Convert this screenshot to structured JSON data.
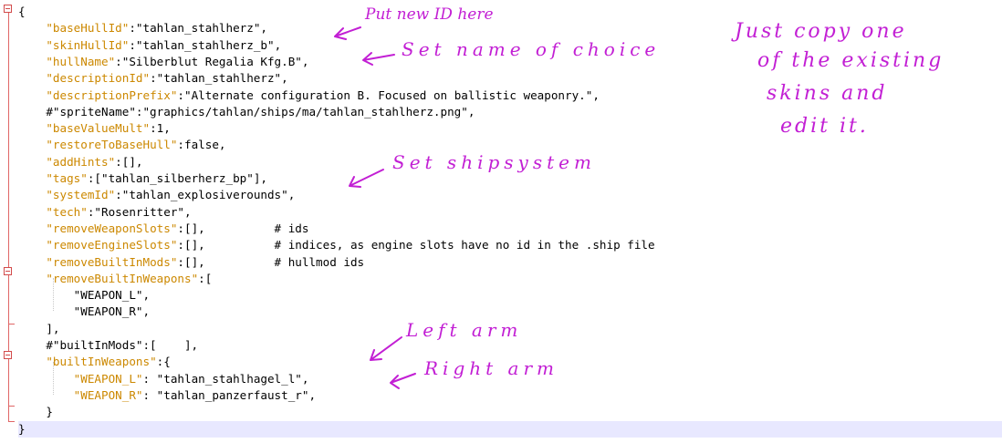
{
  "lines": [
    {
      "t": "{",
      "parts": [
        {
          "c": "{",
          "k": 0
        }
      ]
    },
    {
      "parts": [
        {
          "c": "    ",
          "k": 0
        },
        {
          "c": "\"baseHullId\"",
          "k": 1
        },
        {
          "c": ":\"tahlan_stahlherz\",",
          "k": 0
        }
      ]
    },
    {
      "parts": [
        {
          "c": "    ",
          "k": 0
        },
        {
          "c": "\"skinHullId\"",
          "k": 1
        },
        {
          "c": ":\"tahlan_stahlherz_b\",",
          "k": 0
        }
      ]
    },
    {
      "parts": [
        {
          "c": "    ",
          "k": 0
        },
        {
          "c": "\"hullName\"",
          "k": 1
        },
        {
          "c": ":\"Silberblut Regalia Kfg.B\",",
          "k": 0
        }
      ]
    },
    {
      "parts": [
        {
          "c": "    ",
          "k": 0
        },
        {
          "c": "\"descriptionId\"",
          "k": 1
        },
        {
          "c": ":\"tahlan_stahlherz\",",
          "k": 0
        }
      ]
    },
    {
      "parts": [
        {
          "c": "    ",
          "k": 0
        },
        {
          "c": "\"descriptionPrefix\"",
          "k": 1
        },
        {
          "c": ":\"Alternate configuration B. Focused on ballistic weaponry.\",",
          "k": 0
        }
      ]
    },
    {
      "parts": [
        {
          "c": "    #\"spriteName\":\"graphics/tahlan/ships/ma/tahlan_stahlherz.png\",",
          "k": 0
        }
      ]
    },
    {
      "parts": [
        {
          "c": "    ",
          "k": 0
        },
        {
          "c": "\"baseValueMult\"",
          "k": 1
        },
        {
          "c": ":1,",
          "k": 0
        }
      ]
    },
    {
      "parts": [
        {
          "c": "    ",
          "k": 0
        },
        {
          "c": "\"restoreToBaseHull\"",
          "k": 1
        },
        {
          "c": ":false,",
          "k": 0
        }
      ]
    },
    {
      "parts": [
        {
          "c": "    ",
          "k": 0
        },
        {
          "c": "\"addHints\"",
          "k": 1
        },
        {
          "c": ":[],",
          "k": 0
        }
      ]
    },
    {
      "parts": [
        {
          "c": "    ",
          "k": 0
        },
        {
          "c": "\"tags\"",
          "k": 1
        },
        {
          "c": ":[\"tahlan_silberherz_bp\"],",
          "k": 0
        }
      ]
    },
    {
      "parts": [
        {
          "c": "    ",
          "k": 0
        },
        {
          "c": "\"systemId\"",
          "k": 1
        },
        {
          "c": ":\"tahlan_explosiverounds\",",
          "k": 0
        }
      ]
    },
    {
      "parts": [
        {
          "c": "    ",
          "k": 0
        },
        {
          "c": "\"tech\"",
          "k": 1
        },
        {
          "c": ":\"Rosenritter\",",
          "k": 0
        }
      ]
    },
    {
      "parts": [
        {
          "c": "    ",
          "k": 0
        },
        {
          "c": "\"removeWeaponSlots\"",
          "k": 1
        },
        {
          "c": ":[],          # ids",
          "k": 0
        }
      ]
    },
    {
      "parts": [
        {
          "c": "    ",
          "k": 0
        },
        {
          "c": "\"removeEngineSlots\"",
          "k": 1
        },
        {
          "c": ":[],          # indices, as engine slots have no id in the .ship file",
          "k": 0
        }
      ]
    },
    {
      "parts": [
        {
          "c": "    ",
          "k": 0
        },
        {
          "c": "\"removeBuiltInMods\"",
          "k": 1
        },
        {
          "c": ":[],          # hullmod ids",
          "k": 0
        }
      ]
    },
    {
      "parts": [
        {
          "c": "    ",
          "k": 0
        },
        {
          "c": "\"removeBuiltInWeapons\"",
          "k": 1
        },
        {
          "c": ":[",
          "k": 0
        }
      ]
    },
    {
      "parts": [
        {
          "c": "        \"WEAPON_L\",",
          "k": 0
        }
      ]
    },
    {
      "parts": [
        {
          "c": "        \"WEAPON_R\",",
          "k": 0
        }
      ]
    },
    {
      "parts": [
        {
          "c": "    ],",
          "k": 0
        }
      ]
    },
    {
      "parts": [
        {
          "c": "    #\"builtInMods\":[    ],",
          "k": 0
        }
      ]
    },
    {
      "parts": [
        {
          "c": "    ",
          "k": 0
        },
        {
          "c": "\"builtInWeapons\"",
          "k": 1
        },
        {
          "c": ":{",
          "k": 0
        }
      ]
    },
    {
      "parts": [
        {
          "c": "        ",
          "k": 0
        },
        {
          "c": "\"WEAPON_L\"",
          "k": 1
        },
        {
          "c": ": \"tahlan_stahlhagel_l\",",
          "k": 0
        }
      ]
    },
    {
      "parts": [
        {
          "c": "        ",
          "k": 0
        },
        {
          "c": "\"WEAPON_R\"",
          "k": 1
        },
        {
          "c": ": \"tahlan_panzerfaust_r\",",
          "k": 0
        }
      ]
    },
    {
      "parts": [
        {
          "c": "    }",
          "k": 0
        }
      ]
    },
    {
      "parts": [
        {
          "c": "}",
          "k": 0
        }
      ]
    }
  ],
  "annotations": {
    "put_new_id": "Put new ID here",
    "set_name": "Set name of choice",
    "copy_line1": "Just copy one",
    "copy_line2": "of the existing",
    "copy_line3": "skins and",
    "copy_line4": "edit it.",
    "set_system": "Set shipsystem",
    "left_arm": "Left arm",
    "right_arm": "Right arm"
  },
  "colors": {
    "key": "#cc8800",
    "annotation": "#c21fd4",
    "fold": "#d24a4a"
  }
}
